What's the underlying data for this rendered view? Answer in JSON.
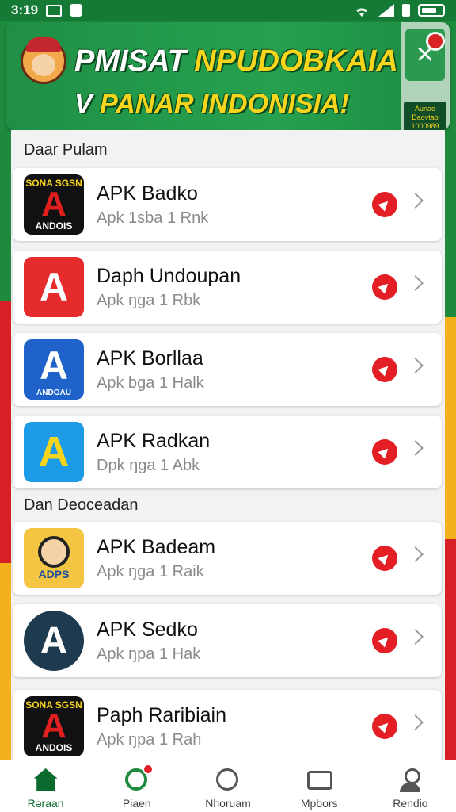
{
  "status_bar": {
    "time": "3:19"
  },
  "banner": {
    "line1_a": "PMISAT",
    "line1_b": " NPUDOBKAIA",
    "line2_a": "V",
    "line2_b": " PANAR INDONISIA!",
    "side_info": "Aunao Daovtab 1000989",
    "menu_icon": "tools-icon"
  },
  "sections": [
    {
      "title": "Daar Pulam",
      "apps": [
        {
          "title": "APK Badko",
          "subtitle": "Apk 1sba 1 Rnk",
          "icon_style": "black",
          "icon_text": "SONA SGSN",
          "icon_label": "ANDOIS"
        },
        {
          "title": "Daph Undoupan",
          "subtitle": "Apk ŋga 1 Rbk",
          "icon_style": "red",
          "icon_text": "A"
        },
        {
          "title": "APK Borllaa",
          "subtitle": "Apk bga 1 Halk",
          "icon_style": "blue",
          "icon_text": "A",
          "icon_label": "ANDOAU"
        },
        {
          "title": "APK Radkan",
          "subtitle": "Dpk ŋga 1 Abk",
          "icon_style": "sky",
          "icon_text": "A"
        }
      ]
    },
    {
      "title": "Dan Deoceadan",
      "apps": [
        {
          "title": "APK Badeam",
          "subtitle": "Apk ŋga 1 Raik",
          "icon_style": "yellow",
          "icon_label": "ADPS"
        },
        {
          "title": "APK Sedko",
          "subtitle": "Apk ŋpa 1 Hak",
          "icon_style": "dark",
          "icon_text": "A"
        },
        {
          "title": "Paph Raribiain",
          "subtitle": "Apk ŋpa 1 Rah",
          "icon_style": "black",
          "icon_text": "SONA SGSN",
          "icon_label": "ANDOIS"
        }
      ]
    }
  ],
  "bottom_nav": [
    {
      "label": "Rəraan",
      "icon": "home-icon",
      "active": true
    },
    {
      "label": "Piaen",
      "icon": "pin-icon",
      "badge": true
    },
    {
      "label": "Nhoruam",
      "icon": "compass-icon"
    },
    {
      "label": "Mpbors",
      "icon": "tv-icon"
    },
    {
      "label": "Rendio",
      "icon": "user-icon"
    }
  ],
  "colors": {
    "brand_green": "#1e8a3e",
    "accent_red": "#e31e24",
    "banner_text": "#f7d51d"
  }
}
